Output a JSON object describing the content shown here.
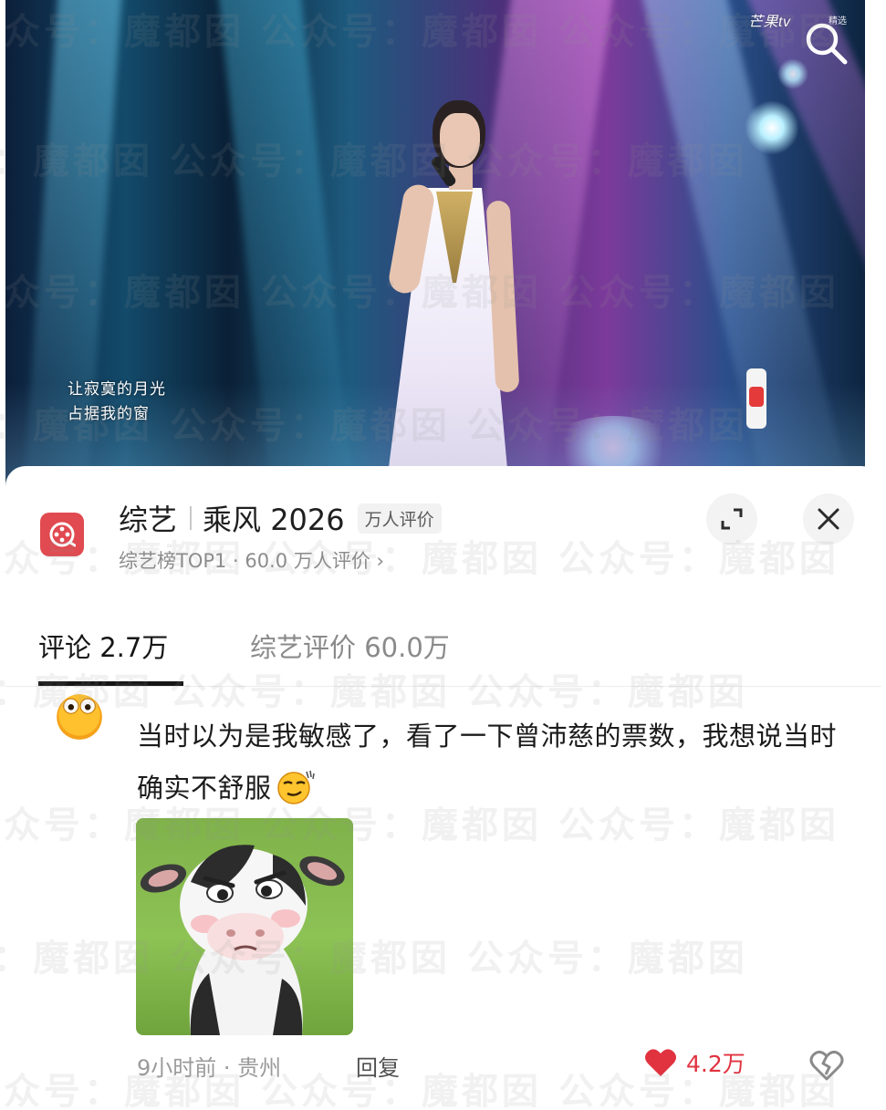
{
  "video": {
    "brand": "芒果tv",
    "brand_sub": "精选",
    "lyrics": [
      "让寂寞的月光",
      "占据我的窗"
    ],
    "search_icon": "search-icon"
  },
  "sheet": {
    "app_icon": "video-reel-icon",
    "title_category": "综艺",
    "title_show": "乘风 2026",
    "title_badge": "万人评价",
    "subtitle": "综艺榜TOP1 · 60.0 万人评价 ›",
    "expand_icon": "expand-icon",
    "close_icon": "close-icon"
  },
  "tabs": [
    {
      "label": "评论 2.7万",
      "active": true
    },
    {
      "label": "综艺评价 60.0万",
      "active": false
    }
  ],
  "comment": {
    "text": "当时以为是我敏感了，看了一下曾沛慈的票数，我想说当时确实不舒服",
    "inline_emoji": "smirk-emoji",
    "sticker": "angry-cow-sticker",
    "meta": "9小时前 · 贵州",
    "reply_label": "回复",
    "like_count": "4.2万",
    "like_icon": "heart-icon",
    "dislike_icon": "broken-heart-icon"
  },
  "watermark": "公众号：魔都囡",
  "colors": {
    "accent_red": "#e0333f",
    "app_icon_red": "#e04a50",
    "text_primary": "#1b1b1b",
    "text_secondary": "#8c8c8c"
  }
}
